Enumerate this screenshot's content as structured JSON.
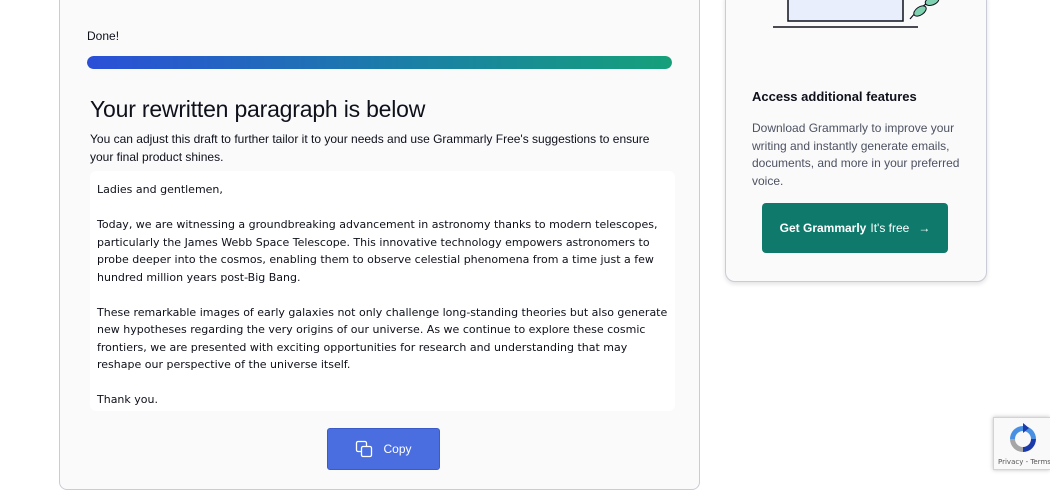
{
  "status": "Done!",
  "progress": 1.0,
  "heading": "Your rewritten paragraph is below",
  "subtext": "You can adjust this draft to further tailor it to your needs and use Grammarly Free's suggestions to ensure your final product shines.",
  "result": {
    "paragraphs": [
      "Ladies and gentlemen,",
      "Today, we are witnessing a groundbreaking advancement in astronomy thanks to modern telescopes, particularly the James Webb Space Telescope. This innovative technology empowers astronomers to probe deeper into the cosmos, enabling them to observe celestial phenomena from a time just a few hundred million years post-Big Bang.",
      "These remarkable images of early galaxies not only challenge long-standing theories but also generate new hypotheses regarding the very origins of our universe. As we continue to explore these cosmic frontiers, we are presented with exciting opportunities for research and understanding that may reshape our perspective of the universe itself.",
      "Thank you."
    ]
  },
  "copy_button": {
    "label": "Copy",
    "icon": "copy-icon"
  },
  "sidebar": {
    "title": "Access additional features",
    "description": "Download Grammarly to improve your writing and instantly generate emails, documents, and more in your preferred voice.",
    "cta": {
      "bold": "Get Grammarly",
      "rest": "It's free",
      "arrow": "→"
    }
  },
  "recaptcha": {
    "privacy": "Privacy",
    "separator": " - ",
    "terms": "Terms"
  },
  "colors": {
    "accent": "#4a6ee0",
    "cta": "#0f7a6c",
    "progress_start": "#2b4fd8",
    "progress_end": "#15a07a"
  }
}
